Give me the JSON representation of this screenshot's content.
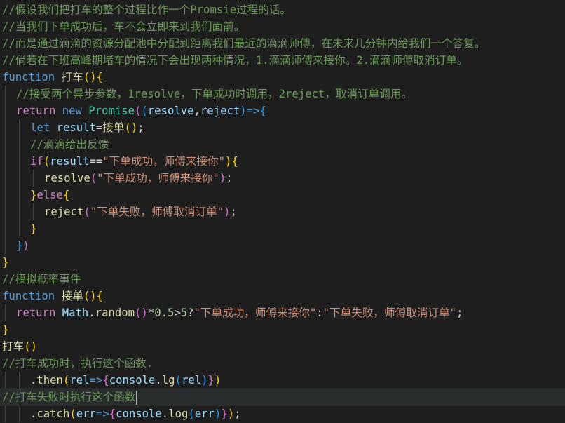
{
  "editor": {
    "lines": [
      {
        "indent": 0,
        "tokens": [
          {
            "t": "//假设我们把打车的整个过程比作一个Promsie过程的话。",
            "c": "c"
          }
        ]
      },
      {
        "indent": 0,
        "tokens": [
          {
            "t": "//当我们下单成功后，车不会立即来到我们面前。",
            "c": "c"
          }
        ]
      },
      {
        "indent": 0,
        "tokens": [
          {
            "t": "//而是通过滴滴的资源分配池中分配到距离我们最近的滴滴师傅，在未来几分钟内给我们一个答复。",
            "c": "c"
          }
        ]
      },
      {
        "indent": 0,
        "tokens": [
          {
            "t": "//倘若在下班高峰期堵车的情况下会出现两种情况，1.滴滴师傅来接你。2.滴滴师傅取消订单。",
            "c": "c"
          }
        ]
      },
      {
        "indent": 0,
        "tokens": [
          {
            "t": "function",
            "c": "k"
          },
          {
            "t": " ",
            "c": "p"
          },
          {
            "t": "打车",
            "c": "f"
          },
          {
            "t": "()",
            "c": "b1"
          },
          {
            "t": "{",
            "c": "b1"
          }
        ]
      },
      {
        "indent": 1,
        "tokens": [
          {
            "t": "//接受两个异步参数，1resolve，下单成功时调用，2reject，取消订单调用。",
            "c": "c"
          }
        ]
      },
      {
        "indent": 1,
        "tokens": [
          {
            "t": "return",
            "c": "ctl"
          },
          {
            "t": " ",
            "c": "p"
          },
          {
            "t": "new",
            "c": "k"
          },
          {
            "t": " ",
            "c": "p"
          },
          {
            "t": "Promise",
            "c": "cls"
          },
          {
            "t": "(",
            "c": "b2"
          },
          {
            "t": "(",
            "c": "b3"
          },
          {
            "t": "resolve",
            "c": "v"
          },
          {
            "t": ",",
            "c": "p"
          },
          {
            "t": "reject",
            "c": "v"
          },
          {
            "t": ")",
            "c": "b3"
          },
          {
            "t": "=>",
            "c": "k"
          },
          {
            "t": "{",
            "c": "b3"
          }
        ]
      },
      {
        "indent": 2,
        "tokens": [
          {
            "t": "let",
            "c": "k"
          },
          {
            "t": " ",
            "c": "p"
          },
          {
            "t": "result",
            "c": "v"
          },
          {
            "t": "=",
            "c": "p"
          },
          {
            "t": "接单",
            "c": "f"
          },
          {
            "t": "()",
            "c": "b1"
          },
          {
            "t": ";",
            "c": "p"
          }
        ]
      },
      {
        "indent": 2,
        "tokens": [
          {
            "t": "//滴滴给出反馈",
            "c": "c"
          }
        ]
      },
      {
        "indent": 2,
        "tokens": [
          {
            "t": "if",
            "c": "ctl"
          },
          {
            "t": "(",
            "c": "b1"
          },
          {
            "t": "result",
            "c": "v"
          },
          {
            "t": "==",
            "c": "p"
          },
          {
            "t": "\"下单成功，师傅来接你\"",
            "c": "s"
          },
          {
            "t": ")",
            "c": "b1"
          },
          {
            "t": "{",
            "c": "b1"
          }
        ]
      },
      {
        "indent": 3,
        "tokens": [
          {
            "t": "resolve",
            "c": "f"
          },
          {
            "t": "(",
            "c": "b2"
          },
          {
            "t": "\"下单成功，师傅来接你\"",
            "c": "s"
          },
          {
            "t": ")",
            "c": "b2"
          },
          {
            "t": ";",
            "c": "p"
          }
        ]
      },
      {
        "indent": 2,
        "tokens": [
          {
            "t": "}",
            "c": "b1"
          },
          {
            "t": "else",
            "c": "ctl"
          },
          {
            "t": "{",
            "c": "b1"
          }
        ]
      },
      {
        "indent": 3,
        "tokens": [
          {
            "t": "reject",
            "c": "f"
          },
          {
            "t": "(",
            "c": "b2"
          },
          {
            "t": "\"下单失败，师傅取消订单\"",
            "c": "s"
          },
          {
            "t": ")",
            "c": "b2"
          },
          {
            "t": ";",
            "c": "p"
          }
        ]
      },
      {
        "indent": 2,
        "tokens": [
          {
            "t": "}",
            "c": "b1"
          }
        ]
      },
      {
        "indent": 1,
        "tokens": [
          {
            "t": "}",
            "c": "b3"
          },
          {
            "t": ")",
            "c": "b2"
          }
        ]
      },
      {
        "indent": 0,
        "tokens": [
          {
            "t": "}",
            "c": "b1"
          }
        ]
      },
      {
        "indent": 0,
        "tokens": [
          {
            "t": "//模拟概率事件",
            "c": "c"
          }
        ]
      },
      {
        "indent": 0,
        "tokens": [
          {
            "t": "function",
            "c": "k"
          },
          {
            "t": " ",
            "c": "p"
          },
          {
            "t": "接单",
            "c": "f"
          },
          {
            "t": "()",
            "c": "b1"
          },
          {
            "t": "{",
            "c": "b1"
          }
        ]
      },
      {
        "indent": 1,
        "tokens": [
          {
            "t": "return",
            "c": "ctl"
          },
          {
            "t": " ",
            "c": "p"
          },
          {
            "t": "Math",
            "c": "v"
          },
          {
            "t": ".",
            "c": "p"
          },
          {
            "t": "random",
            "c": "f"
          },
          {
            "t": "()",
            "c": "b2"
          },
          {
            "t": "*",
            "c": "p"
          },
          {
            "t": "0.5",
            "c": "n"
          },
          {
            "t": ">",
            "c": "p"
          },
          {
            "t": "5",
            "c": "n"
          },
          {
            "t": "?",
            "c": "p"
          },
          {
            "t": "\"下单成功，师傅来接你\"",
            "c": "s"
          },
          {
            "t": ":",
            "c": "p"
          },
          {
            "t": "\"下单失败，师傅取消订单\"",
            "c": "s"
          },
          {
            "t": ";",
            "c": "p"
          }
        ]
      },
      {
        "indent": 0,
        "tokens": [
          {
            "t": "}",
            "c": "b1"
          }
        ]
      },
      {
        "indent": 0,
        "tokens": [
          {
            "t": "打车",
            "c": "f"
          },
          {
            "t": "()",
            "c": "b1"
          }
        ]
      },
      {
        "indent": 0,
        "tokens": [
          {
            "t": "//打车成功时，执行这个函数.",
            "c": "c"
          }
        ]
      },
      {
        "indent": 2,
        "tokens": [
          {
            "t": ".",
            "c": "p"
          },
          {
            "t": "then",
            "c": "f"
          },
          {
            "t": "(",
            "c": "b1"
          },
          {
            "t": "rel",
            "c": "v"
          },
          {
            "t": "=>",
            "c": "k"
          },
          {
            "t": "{",
            "c": "b2"
          },
          {
            "t": "console",
            "c": "v"
          },
          {
            "t": ".",
            "c": "p"
          },
          {
            "t": "lg",
            "c": "f"
          },
          {
            "t": "(",
            "c": "b3"
          },
          {
            "t": "rel",
            "c": "v"
          },
          {
            "t": ")",
            "c": "b3"
          },
          {
            "t": "}",
            "c": "b2"
          },
          {
            "t": ")",
            "c": "b1"
          }
        ]
      },
      {
        "indent": 0,
        "current": true,
        "cursor": true,
        "tokens": [
          {
            "t": "//打车失败时执行这个函数",
            "c": "c"
          }
        ]
      },
      {
        "indent": 2,
        "tokens": [
          {
            "t": ".",
            "c": "p"
          },
          {
            "t": "catch",
            "c": "f"
          },
          {
            "t": "(",
            "c": "b1"
          },
          {
            "t": "err",
            "c": "v"
          },
          {
            "t": "=>",
            "c": "k"
          },
          {
            "t": "{",
            "c": "b2"
          },
          {
            "t": "console",
            "c": "v"
          },
          {
            "t": ".",
            "c": "p"
          },
          {
            "t": "log",
            "c": "f"
          },
          {
            "t": "(",
            "c": "b3"
          },
          {
            "t": "err",
            "c": "v"
          },
          {
            "t": ")",
            "c": "b3"
          },
          {
            "t": "}",
            "c": "b2"
          },
          {
            "t": ")",
            "c": "b1"
          },
          {
            "t": ";",
            "c": "p"
          }
        ]
      }
    ]
  },
  "theme": {
    "background": "#1e1e1e",
    "comment": "#6a9955",
    "keyword": "#569cd6",
    "control": "#c586c0",
    "function": "#dcdcaa",
    "variable": "#9cdcfe",
    "string": "#ce9178",
    "number": "#b5cea8",
    "class": "#4ec9b0",
    "bracket_1": "#ffd700",
    "bracket_2": "#da70d6",
    "bracket_3": "#179fff"
  }
}
